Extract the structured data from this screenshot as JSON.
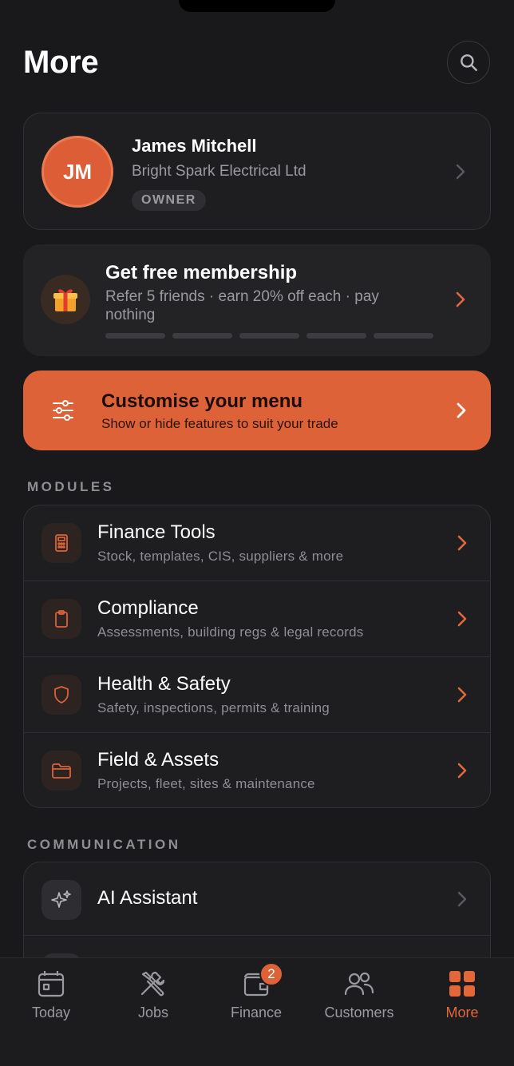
{
  "header": {
    "title": "More"
  },
  "profile": {
    "initials": "JM",
    "name": "James Mitchell",
    "company": "Bright Spark Electrical Ltd",
    "role": "OWNER"
  },
  "promo": {
    "title": "Get free membership",
    "description": "Refer 5 friends · earn 20% off each · pay nothing",
    "progress_completed": 0,
    "progress_total": 5
  },
  "customise": {
    "title": "Customise your menu",
    "description": "Show or hide features to suit your trade"
  },
  "sections": {
    "modules": {
      "label": "MODULES",
      "items": [
        {
          "title": "Finance Tools",
          "subtitle": "Stock, templates, CIS, suppliers & more",
          "icon": "calculator-icon"
        },
        {
          "title": "Compliance",
          "subtitle": "Assessments, building regs & legal records",
          "icon": "clipboard-icon"
        },
        {
          "title": "Health & Safety",
          "subtitle": "Safety, inspections, permits & training",
          "icon": "shield-icon"
        },
        {
          "title": "Field & Assets",
          "subtitle": "Projects, fleet, sites & maintenance",
          "icon": "folder-icon"
        }
      ]
    },
    "communication": {
      "label": "COMMUNICATION",
      "items": [
        {
          "title": "AI Assistant",
          "icon": "sparkles-icon"
        }
      ]
    }
  },
  "tabbar": {
    "items": [
      {
        "label": "Today",
        "icon": "calendar-icon"
      },
      {
        "label": "Jobs",
        "icon": "tools-icon"
      },
      {
        "label": "Finance",
        "icon": "wallet-icon",
        "badge": "2"
      },
      {
        "label": "Customers",
        "icon": "people-icon"
      },
      {
        "label": "More",
        "icon": "grid-icon",
        "active": true
      }
    ]
  },
  "colors": {
    "accent": "#dd6237",
    "background": "#19191b",
    "card": "#1e1e21"
  }
}
